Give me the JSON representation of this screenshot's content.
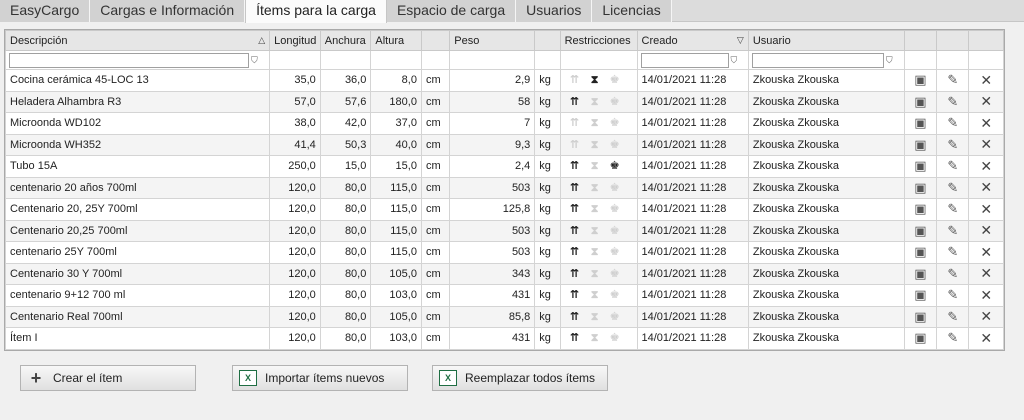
{
  "tabs": [
    "EasyCargo",
    "Cargas e Información",
    "Ítems para la carga",
    "Espacio de carga",
    "Usuarios",
    "Licencias"
  ],
  "active_tab": 2,
  "columns": {
    "descripcion": "Descripción",
    "longitud": "Longitud",
    "anchura": "Anchura",
    "altura": "Altura",
    "peso": "Peso",
    "restricciones": "Restricciones",
    "creado": "Creado",
    "usuario": "Usuario"
  },
  "rows": [
    {
      "desc": "Cocina cerámica 45-LOC 13",
      "len": "35,0",
      "wid": "36,0",
      "hei": "8,0",
      "unit": "cm",
      "weight": "2,9",
      "wunit": "kg",
      "r": [
        false,
        true,
        false
      ],
      "created": "14/01/2021 11:28",
      "user": "Zkouska Zkouska"
    },
    {
      "desc": "Heladera Alhambra R3",
      "len": "57,0",
      "wid": "57,6",
      "hei": "180,0",
      "unit": "cm",
      "weight": "58",
      "wunit": "kg",
      "r": [
        true,
        false,
        false
      ],
      "created": "14/01/2021 11:28",
      "user": "Zkouska Zkouska"
    },
    {
      "desc": "Microonda WD102",
      "len": "38,0",
      "wid": "42,0",
      "hei": "37,0",
      "unit": "cm",
      "weight": "7",
      "wunit": "kg",
      "r": [
        false,
        false,
        false
      ],
      "created": "14/01/2021 11:28",
      "user": "Zkouska Zkouska"
    },
    {
      "desc": "Microonda WH352",
      "len": "41,4",
      "wid": "50,3",
      "hei": "40,0",
      "unit": "cm",
      "weight": "9,3",
      "wunit": "kg",
      "r": [
        false,
        false,
        false
      ],
      "created": "14/01/2021 11:28",
      "user": "Zkouska Zkouska"
    },
    {
      "desc": "Tubo 15A",
      "len": "250,0",
      "wid": "15,0",
      "hei": "15,0",
      "unit": "cm",
      "weight": "2,4",
      "wunit": "kg",
      "r": [
        true,
        false,
        true
      ],
      "created": "14/01/2021 11:28",
      "user": "Zkouska Zkouska"
    },
    {
      "desc": "centenario 20 años 700ml",
      "len": "120,0",
      "wid": "80,0",
      "hei": "115,0",
      "unit": "cm",
      "weight": "503",
      "wunit": "kg",
      "r": [
        true,
        false,
        false
      ],
      "created": "14/01/2021 11:28",
      "user": "Zkouska Zkouska"
    },
    {
      "desc": "Centenario 20, 25Y 700ml",
      "len": "120,0",
      "wid": "80,0",
      "hei": "115,0",
      "unit": "cm",
      "weight": "125,8",
      "wunit": "kg",
      "r": [
        true,
        false,
        false
      ],
      "created": "14/01/2021 11:28",
      "user": "Zkouska Zkouska"
    },
    {
      "desc": "Centenario 20,25 700ml",
      "len": "120,0",
      "wid": "80,0",
      "hei": "115,0",
      "unit": "cm",
      "weight": "503",
      "wunit": "kg",
      "r": [
        true,
        false,
        false
      ],
      "created": "14/01/2021 11:28",
      "user": "Zkouska Zkouska"
    },
    {
      "desc": "centenario 25Y 700ml",
      "len": "120,0",
      "wid": "80,0",
      "hei": "115,0",
      "unit": "cm",
      "weight": "503",
      "wunit": "kg",
      "r": [
        true,
        false,
        false
      ],
      "created": "14/01/2021 11:28",
      "user": "Zkouska Zkouska"
    },
    {
      "desc": "Centenario 30 Y 700ml",
      "len": "120,0",
      "wid": "80,0",
      "hei": "105,0",
      "unit": "cm",
      "weight": "343",
      "wunit": "kg",
      "r": [
        true,
        false,
        false
      ],
      "created": "14/01/2021 11:28",
      "user": "Zkouska Zkouska"
    },
    {
      "desc": "centenario 9+12 700 ml",
      "len": "120,0",
      "wid": "80,0",
      "hei": "103,0",
      "unit": "cm",
      "weight": "431",
      "wunit": "kg",
      "r": [
        true,
        false,
        false
      ],
      "created": "14/01/2021 11:28",
      "user": "Zkouska Zkouska"
    },
    {
      "desc": "Centenario Real 700ml",
      "len": "120,0",
      "wid": "80,0",
      "hei": "105,0",
      "unit": "cm",
      "weight": "85,8",
      "wunit": "kg",
      "r": [
        true,
        false,
        false
      ],
      "created": "14/01/2021 11:28",
      "user": "Zkouska Zkouska"
    },
    {
      "desc": "Ítem I",
      "len": "120,0",
      "wid": "80,0",
      "hei": "103,0",
      "unit": "cm",
      "weight": "431",
      "wunit": "kg",
      "r": [
        true,
        false,
        false
      ],
      "created": "14/01/2021 11:28",
      "user": "Zkouska Zkouska"
    }
  ],
  "buttons": {
    "create": "Crear el ítem",
    "import": "Importar ítems nuevos",
    "replace": "Reemplazar todos ítems"
  },
  "icons": {
    "restriction_1": "up-arrows-icon",
    "restriction_2": "hourglass-icon",
    "restriction_3": "stack-top-icon",
    "row_action_1": "box-3d-icon",
    "row_action_2": "edit-pencil-icon",
    "row_action_3": "delete-x-icon"
  }
}
